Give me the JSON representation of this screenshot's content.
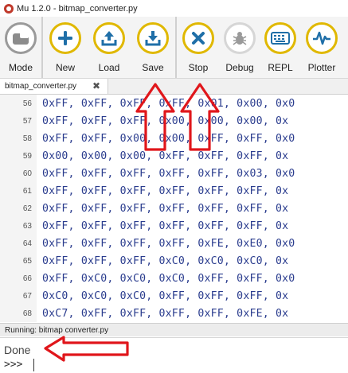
{
  "window": {
    "title": "Mu 1.2.0 - bitmap_converter.py"
  },
  "toolbar": {
    "buttons": [
      {
        "id": "mode",
        "label": "Mode",
        "icon": "mode-icon"
      },
      {
        "id": "new",
        "label": "New",
        "icon": "plus-icon"
      },
      {
        "id": "load",
        "label": "Load",
        "icon": "upload-icon"
      },
      {
        "id": "save",
        "label": "Save",
        "icon": "download-icon"
      },
      {
        "id": "stop",
        "label": "Stop",
        "icon": "x-icon"
      },
      {
        "id": "debug",
        "label": "Debug",
        "icon": "bug-icon"
      },
      {
        "id": "repl",
        "label": "REPL",
        "icon": "keyboard-icon"
      },
      {
        "id": "plotter",
        "label": "Plotter",
        "icon": "pulse-icon"
      }
    ]
  },
  "tabs": [
    {
      "label": "bitmap_converter.py",
      "close": "✖"
    }
  ],
  "editor": {
    "lines": [
      {
        "num": "56",
        "text": "0xFF, 0xFF, 0xFF, 0xFF, 0x01, 0x00, 0x0"
      },
      {
        "num": "57",
        "text": "0xFF, 0xFF, 0xFF, 0x00, 0x00, 0x00, 0x"
      },
      {
        "num": "58",
        "text": "0xFF, 0xFF, 0x00, 0x00, 0xFF, 0xFF, 0x0"
      },
      {
        "num": "59",
        "text": "0x00, 0x00, 0x00, 0xFF, 0xFF, 0xFF, 0x"
      },
      {
        "num": "60",
        "text": "0xFF, 0xFF, 0xFF, 0xFF, 0xFF, 0x03, 0x0"
      },
      {
        "num": "61",
        "text": "0xFF, 0xFF, 0xFF, 0xFF, 0xFF, 0xFF, 0x"
      },
      {
        "num": "62",
        "text": "0xFF, 0xFF, 0xFF, 0xFF, 0xFF, 0xFF, 0x"
      },
      {
        "num": "63",
        "text": "0xFF, 0xFF, 0xFF, 0xFF, 0xFF, 0xFF, 0x"
      },
      {
        "num": "64",
        "text": "0xFF, 0xFF, 0xFF, 0xFF, 0xFE, 0xE0, 0x0"
      },
      {
        "num": "65",
        "text": "0xFF, 0xFF, 0xFF, 0xC0, 0xC0, 0xC0, 0x"
      },
      {
        "num": "66",
        "text": "0xFF, 0xC0, 0xC0, 0xC0, 0xFF, 0xFF, 0x0"
      },
      {
        "num": "67",
        "text": "0xC0, 0xC0, 0xC0, 0xFF, 0xFF, 0xFF, 0x"
      },
      {
        "num": "68",
        "text": "0xC7, 0xFF, 0xFF, 0xFF, 0xFF, 0xFE, 0x"
      }
    ]
  },
  "status": {
    "running_text": "Running: bitmap converter.py"
  },
  "repl": {
    "output": "Done",
    "prompt": ">>>"
  },
  "colors": {
    "code_text": "#2a3c8e",
    "button_ring": "#e0b800",
    "button_icon": "#1f6fa8",
    "annotation_arrow": "#e0161b"
  }
}
